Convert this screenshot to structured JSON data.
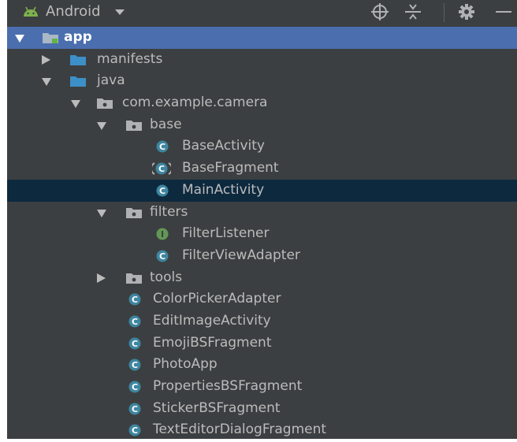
{
  "toolbar": {
    "view_label": "Android",
    "icons": [
      "android-icon",
      "crosshair-icon",
      "collapse-all-icon",
      "gear-icon",
      "minimize-icon"
    ]
  },
  "colors": {
    "panel_bg": "#3c3f41",
    "root_selection": "#4b6eaf",
    "row_selection": "#0d293e",
    "folder_blue": "#3d8fc7",
    "class_icon": "#3e86a0",
    "interface_icon": "#629755",
    "text": "#bbbbbb"
  },
  "tree": {
    "app": "app",
    "manifests": "manifests",
    "java": "java",
    "package": "com.example.camera",
    "base": "base",
    "base_activity": "BaseActivity",
    "base_fragment": "BaseFragment",
    "main_activity": "MainActivity",
    "filters": "filters",
    "filter_listener": "FilterListener",
    "filter_view_adapter": "FilterViewAdapter",
    "tools": "tools",
    "color_picker_adapter": "ColorPickerAdapter",
    "edit_image_activity": "EditImageActivity",
    "emoji_bs_fragment": "EmojiBSFragment",
    "photo_app": "PhotoApp",
    "properties_bs_fragment": "PropertiesBSFragment",
    "sticker_bs_fragment": "StickerBSFragment",
    "text_editor_dialog_fragment": "TextEditorDialogFragment"
  },
  "icon_letters": {
    "class": "C",
    "interface": "I"
  }
}
